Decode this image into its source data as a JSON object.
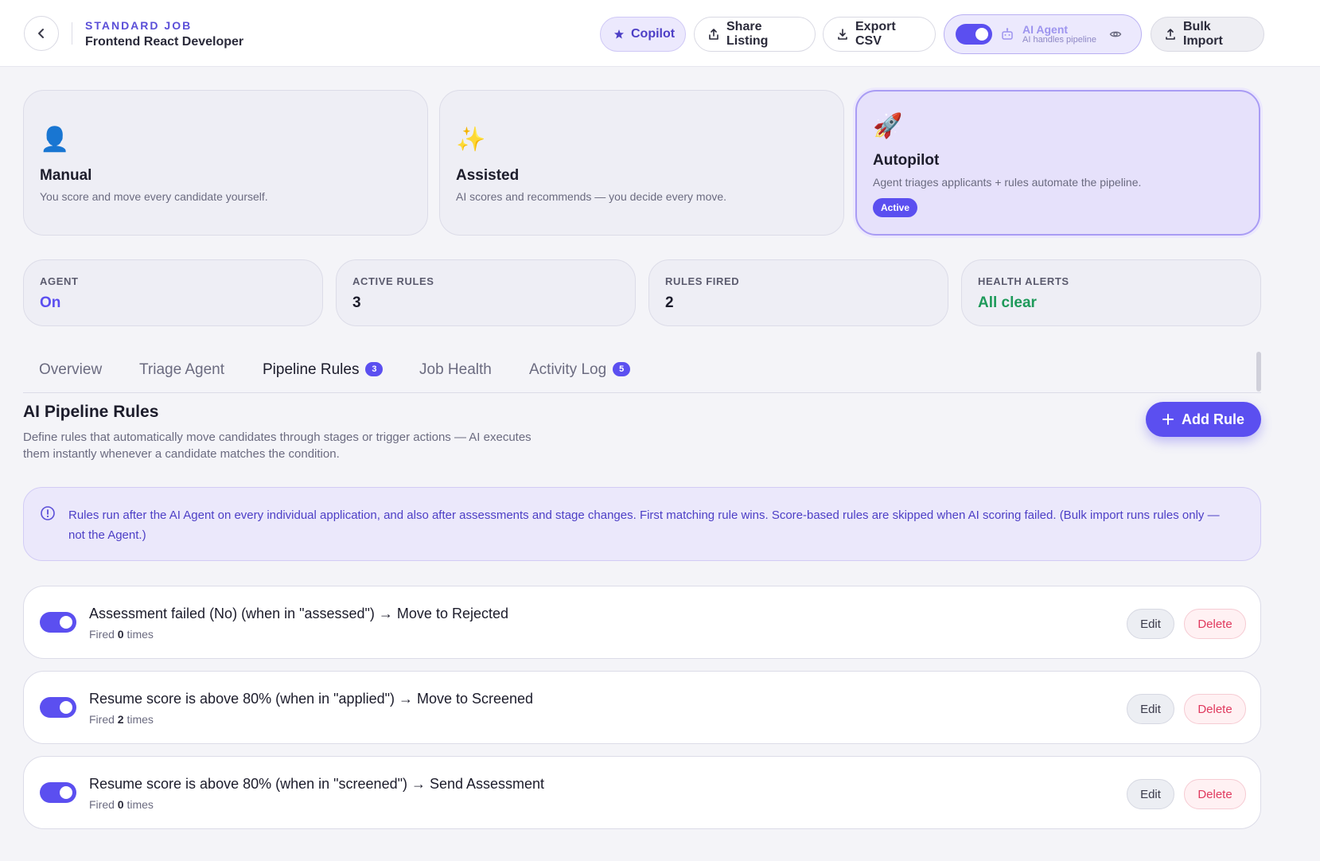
{
  "header": {
    "job_type": "STANDARD JOB",
    "job_title": "Frontend React Developer",
    "copilot_label": "Copilot",
    "share_label": "Share Listing",
    "export_label": "Export CSV",
    "agent_title": "AI Agent",
    "agent_subtitle": "AI handles pipeline",
    "bulk_label": "Bulk Import"
  },
  "modes": [
    {
      "icon": "👤",
      "name": "Manual",
      "desc": "You score and move every candidate yourself."
    },
    {
      "icon": "✨",
      "name": "Assisted",
      "desc": "AI scores and recommends — you decide every move."
    },
    {
      "icon": "🚀",
      "name": "Autopilot",
      "desc": "Agent triages applicants + rules automate the pipeline.",
      "badge": "Active"
    }
  ],
  "stats": [
    {
      "label": "AGENT",
      "value": "On"
    },
    {
      "label": "ACTIVE RULES",
      "value": "3"
    },
    {
      "label": "RULES FIRED",
      "value": "2"
    },
    {
      "label": "HEALTH ALERTS",
      "value": "All clear"
    }
  ],
  "tabs": [
    {
      "label": "Overview"
    },
    {
      "label": "Triage Agent"
    },
    {
      "label": "Pipeline Rules",
      "badge": "3"
    },
    {
      "label": "Job Health"
    },
    {
      "label": "Activity Log",
      "badge": "5"
    }
  ],
  "section": {
    "title": "AI Pipeline Rules",
    "description": "Define rules that automatically move candidates through stages or trigger actions — AI executes them instantly whenever a candidate matches the condition.",
    "add_rule_label": "Add Rule",
    "info_text": "Rules run after the AI Agent on every individual application, and also after assessments and stage changes. First matching rule wins. Score-based rules are skipped when AI scoring failed. (Bulk import runs rules only — not the Agent.)"
  },
  "rules": [
    {
      "title": "Assessment failed (No) (when in \"assessed\") → Move to Rejected",
      "fired_prefix": "Fired",
      "fired_count": "0",
      "fired_suffix": "times",
      "edit": "Edit",
      "delete": "Delete"
    },
    {
      "title": "Resume score is above 80% (when in \"applied\") → Move to Screened",
      "fired_prefix": "Fired",
      "fired_count": "2",
      "fired_suffix": "times",
      "edit": "Edit",
      "delete": "Delete"
    },
    {
      "title": "Resume score is above 80% (when in \"screened\") → Send Assessment",
      "fired_prefix": "Fired",
      "fired_count": "0",
      "fired_suffix": "times",
      "edit": "Edit",
      "delete": "Delete"
    }
  ],
  "colors": {
    "accent": "#5b4ff0",
    "success": "#1e9a5a",
    "danger": "#e0395e"
  }
}
